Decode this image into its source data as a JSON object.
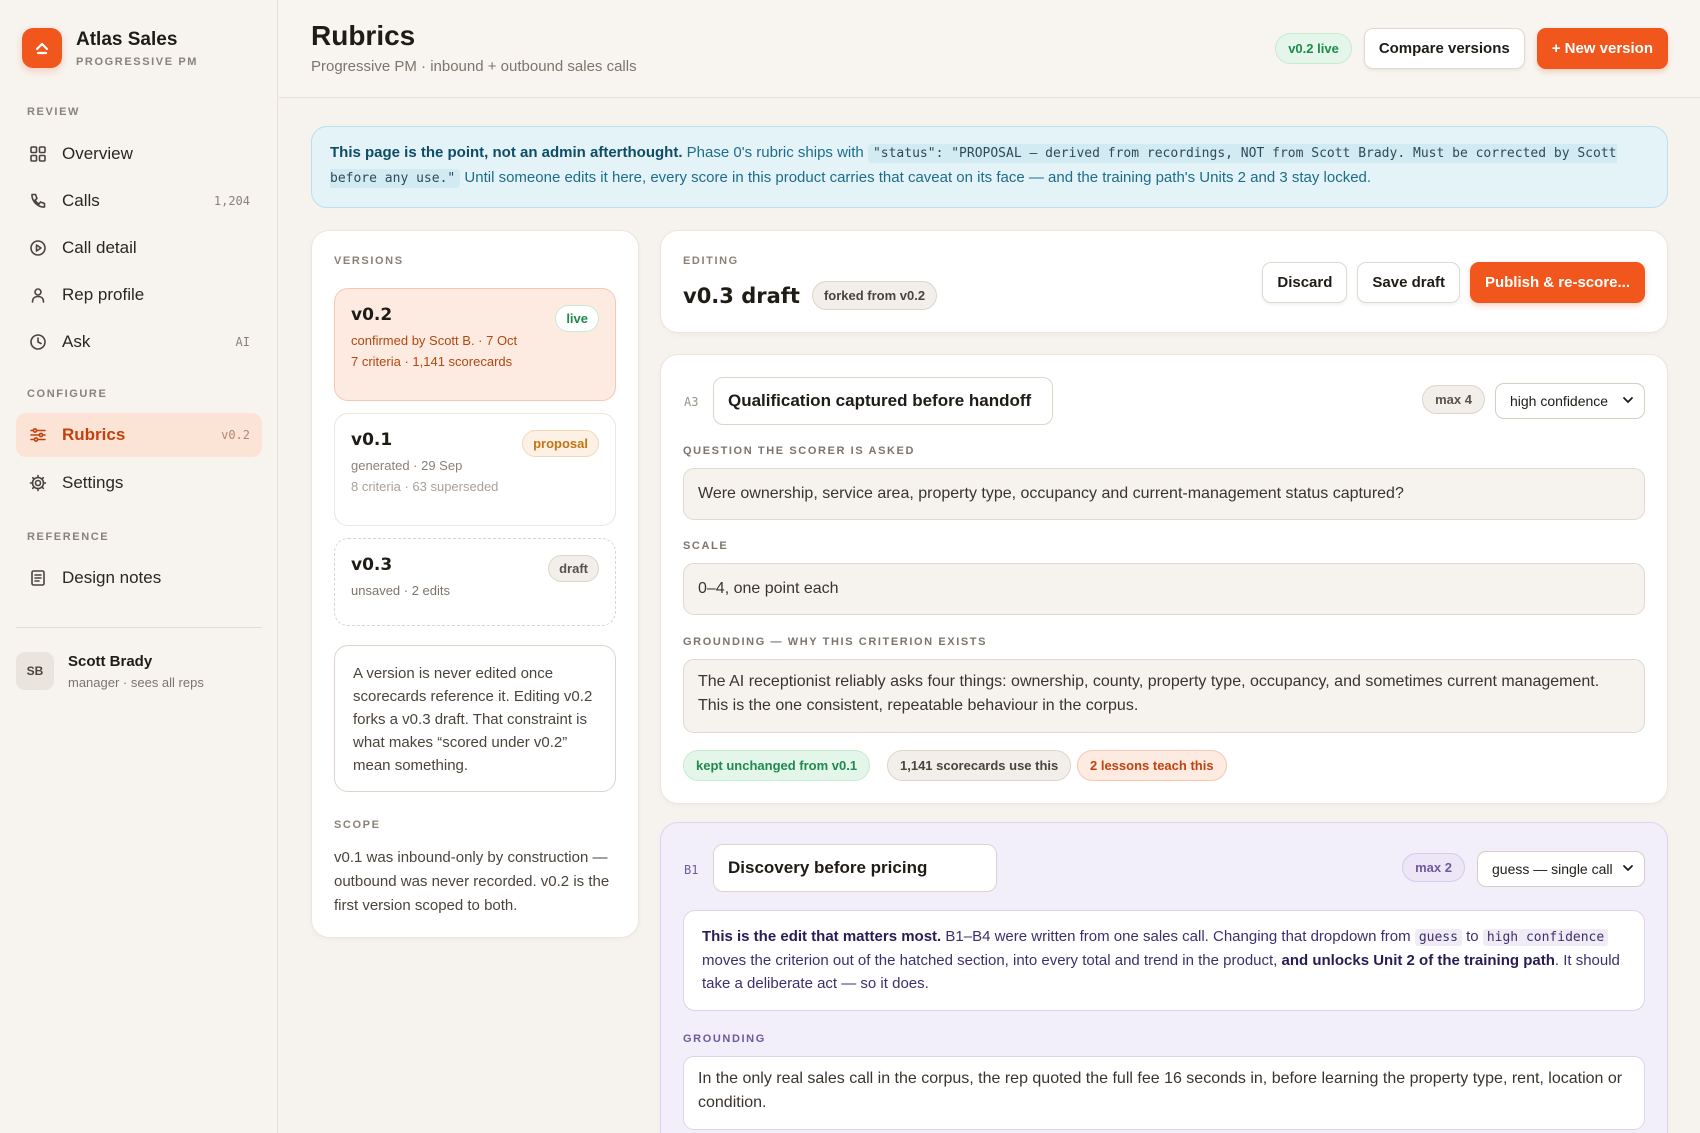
{
  "brand": {
    "name": "Atlas Sales",
    "sub": "PROGRESSIVE PM"
  },
  "sidebar": {
    "review_label": "REVIEW",
    "configure_label": "CONFIGURE",
    "reference_label": "REFERENCE",
    "items": [
      {
        "label": "Overview",
        "aux": ""
      },
      {
        "label": "Calls",
        "aux": "1,204"
      },
      {
        "label": "Call detail",
        "aux": ""
      },
      {
        "label": "Rep profile",
        "aux": ""
      },
      {
        "label": "Ask",
        "aux": "AI"
      },
      {
        "label": "Rubrics",
        "aux": "v0.2"
      },
      {
        "label": "Settings",
        "aux": ""
      },
      {
        "label": "Design notes",
        "aux": ""
      }
    ],
    "user": {
      "initials": "SB",
      "name": "Scott Brady",
      "role": "manager · sees all reps"
    }
  },
  "header": {
    "title": "Rubrics",
    "subtitle": "Progressive PM · inbound + outbound sales calls",
    "live_pill": "v0.2 live",
    "compare_label": "Compare versions",
    "new_version_label": "+ New version"
  },
  "banner": {
    "bold": "This page is the point, not an admin afterthought.",
    "text1": "Phase 0's rubric ships with",
    "code": "\"status\": \"PROPOSAL — derived from recordings, NOT from Scott Brady. Must be corrected by Scott before any use.\"",
    "text2": "Until someone edits it here, every score in this product carries that caveat on its face — and the training path's Units 2 and 3 stay locked."
  },
  "versions": {
    "label": "VERSIONS",
    "items": [
      {
        "name": "v0.2",
        "badge": "live",
        "line1": "confirmed by Scott B. · 7 Oct",
        "line2": "7 criteria · 1,141 scorecards"
      },
      {
        "name": "v0.1",
        "badge": "proposal",
        "line1": "generated · 29 Sep",
        "line2": "8 criteria · 63 superseded"
      },
      {
        "name": "v0.3",
        "badge": "draft",
        "line1": "unsaved · 2 edits",
        "line2": ""
      }
    ],
    "note": "A version is never edited once scorecards reference it. Editing v0.2 forks a v0.3 draft. That constraint is what makes “scored under v0.2” mean something.",
    "scope_label": "SCOPE",
    "scope_text": "v0.1 was inbound-only by construction — outbound was never recorded. v0.2 is the first version scoped to both."
  },
  "editing": {
    "label": "EDITING",
    "title": "v0.3 draft",
    "fork_pill": "forked from v0.2",
    "discard_label": "Discard",
    "save_label": "Save draft",
    "publish_label": "Publish & re-score..."
  },
  "criterion_a": {
    "code": "A3",
    "name": "Qualification captured before handoff",
    "max": "max 4",
    "confidence": "high confidence",
    "question_label": "QUESTION THE SCORER IS ASKED",
    "question": "Were ownership, service area, property type, occupancy and current-management status captured?",
    "scale_label": "SCALE",
    "scale": "0–4, one point each",
    "grounding_label": "GROUNDING — WHY THIS CRITERION EXISTS",
    "grounding": "The AI receptionist reliably asks four things: ownership, county, property type, occupancy, and sometimes current management. This is the one consistent, repeatable behaviour in the corpus.",
    "tags": [
      "kept unchanged from v0.1",
      "1,141 scorecards use this",
      "2 lessons teach this"
    ]
  },
  "criterion_b": {
    "code": "B1",
    "name": "Discovery before pricing",
    "max": "max 2",
    "confidence": "guess — single call",
    "callout_bold": "This is the edit that matters most.",
    "callout_text1": "B1–B4 were written from one sales call. Changing that dropdown from",
    "callout_code1": "guess",
    "callout_to": "to",
    "callout_code2": "high confidence",
    "callout_text2": "moves the criterion out of the hatched section, into every total and trend in the product,",
    "callout_bold2": "and unlocks Unit 2 of the training path",
    "callout_text3": ". It should take a deliberate act — so it does.",
    "grounding_label": "GROUNDING",
    "grounding": "In the only real sales call in the corpus, the rep quoted the full fee 16 seconds in, before learning the property type, rent, location or condition."
  },
  "colors": {
    "accent": "#f1561d",
    "live_green": "#1f8a4c",
    "banner_blue": "#e3f3f8",
    "purple_tint": "#f3effa"
  }
}
